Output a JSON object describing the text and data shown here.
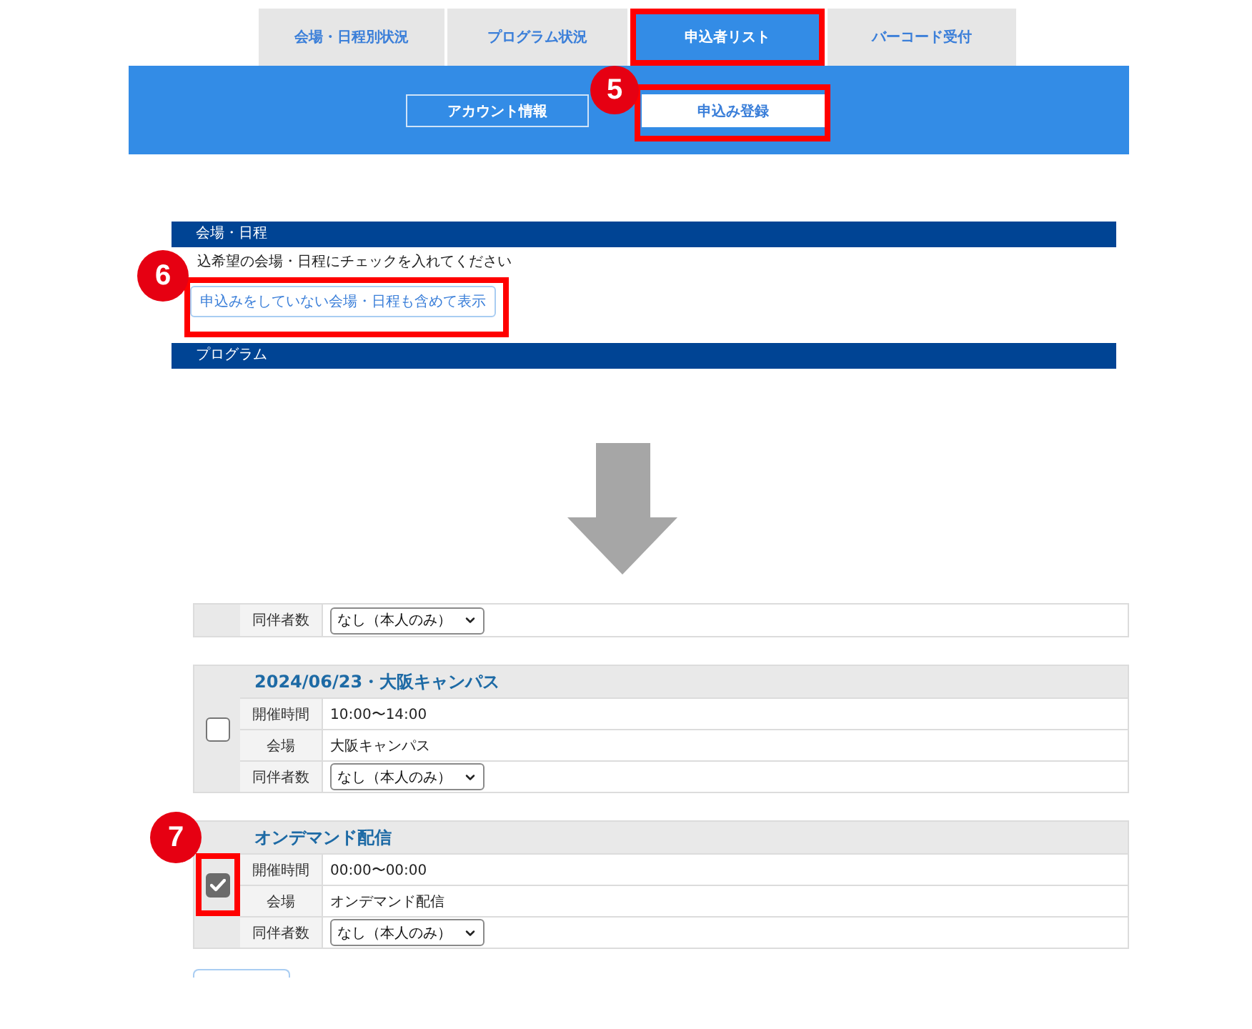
{
  "top_screen": {
    "tabs": [
      {
        "label": "会場・日程別状況",
        "selected": false,
        "highlighted": false
      },
      {
        "label": "プログラム状況",
        "selected": false,
        "highlighted": false
      },
      {
        "label": "申込者リスト",
        "selected": true,
        "highlighted": true
      },
      {
        "label": "バーコード受付",
        "selected": false,
        "highlighted": false
      }
    ],
    "subtabs": [
      {
        "label": "アカウント情報",
        "selected": false,
        "highlighted": false
      },
      {
        "label": "申込み登録",
        "selected": true,
        "highlighted": true,
        "badge": "5"
      }
    ],
    "sections": [
      {
        "title": "会場・日程",
        "instruction": "込希望の会場・日程にチェックを入れてください",
        "button": {
          "label": "申込みをしていない会場・日程も含めて表示",
          "highlighted": true,
          "badge": "6"
        }
      },
      {
        "title": "プログラム"
      }
    ]
  },
  "bottom_screen": {
    "sessions": [
      {
        "rows": [
          {
            "label": "同伴者数",
            "kind": "select",
            "value": "なし（本人のみ）"
          }
        ]
      },
      {
        "title": "2024/06/23・大阪キャンパス",
        "checked": false,
        "highlighted": false,
        "rows": [
          {
            "label": "開催時間",
            "kind": "text",
            "value": "10:00〜14:00"
          },
          {
            "label": "会場",
            "kind": "text",
            "value": "大阪キャンパス"
          },
          {
            "label": "同伴者数",
            "kind": "select",
            "value": "なし（本人のみ）"
          }
        ]
      },
      {
        "title": "オンデマンド配信",
        "checked": true,
        "highlighted": true,
        "badge": "7",
        "rows": [
          {
            "label": "開催時間",
            "kind": "text",
            "value": "00:00〜00:00"
          },
          {
            "label": "会場",
            "kind": "text",
            "value": "オンデマンド配信"
          },
          {
            "label": "同伴者数",
            "kind": "select",
            "value": "なし（本人のみ）"
          }
        ]
      }
    ]
  }
}
